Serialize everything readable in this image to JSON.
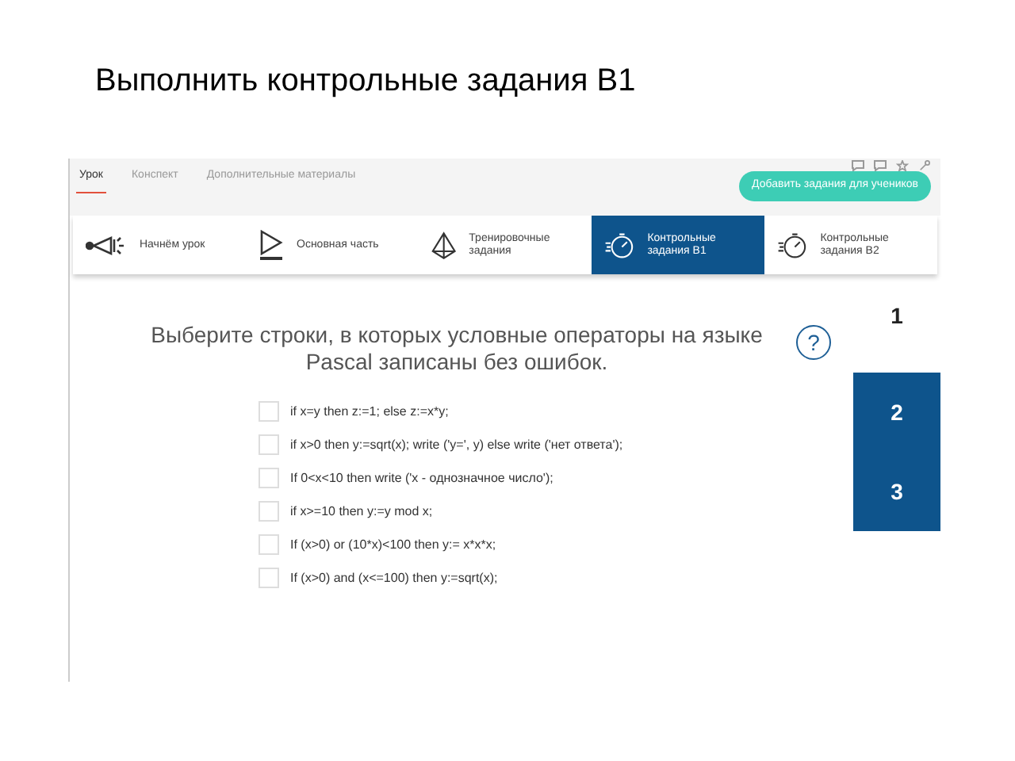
{
  "slide_title": "Выполнить контрольные задания В1",
  "page_tabs": [
    {
      "label": "Урок",
      "selected": true
    },
    {
      "label": "Конспект",
      "selected": false
    },
    {
      "label": "Дополнительные материалы",
      "selected": false
    }
  ],
  "add_button": "Добавить задания для учеников",
  "sections": [
    {
      "label": "Начнём урок",
      "kind": "megaphone",
      "selected": false
    },
    {
      "label": "Основная часть",
      "kind": "play",
      "selected": false
    },
    {
      "label": "Тренировочные задания",
      "kind": "pyramid",
      "selected": false
    },
    {
      "label": "Контрольные задания В1",
      "kind": "timer",
      "selected": true
    },
    {
      "label": "Контрольные задания В2",
      "kind": "timer",
      "selected": false
    }
  ],
  "question": {
    "prompt": "Выберите строки, в которых условные операторы на языке Pascal записаны без ошибок.",
    "help": "?",
    "options": [
      {
        "label": "if x=y then z:=1; else z:=x*y;",
        "checked": false
      },
      {
        "label": "if x>0 then y:=sqrt(x); write ('y=', y) else write ('нет ответа');",
        "checked": false
      },
      {
        "label": "If 0<x<10 then write ('x - однозначное число');",
        "checked": false
      },
      {
        "label": "if x>=10 then y:=y mod x;",
        "checked": false
      },
      {
        "label": "If (x>0) or (10*x)<100 then y:= x*x*x;",
        "checked": false
      },
      {
        "label": "If (x>0) and (x<=100) then y:=sqrt(x);",
        "checked": false
      }
    ]
  },
  "task_numbers": [
    {
      "label": "1",
      "selected": true
    },
    {
      "label": "2",
      "selected": false
    },
    {
      "label": "3",
      "selected": false
    }
  ]
}
